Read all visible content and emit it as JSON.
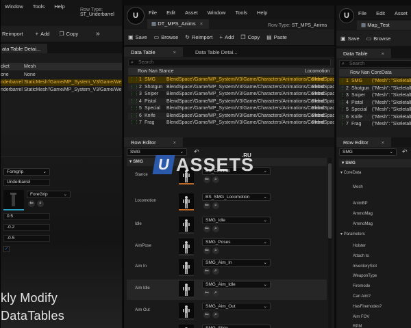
{
  "left_window": {
    "menu": [
      "Window",
      "Tools",
      "Help"
    ],
    "row_type_label": "Row Type:",
    "row_type_value": "ST_Underbarrel",
    "toolbar": {
      "reimport": "Reimport",
      "add": "Add",
      "copy": "Copy",
      "more": "»"
    },
    "tab": "ata Table Detai...",
    "table_headers": [
      "cket",
      "Mesh"
    ],
    "rows": [
      {
        "name": "one",
        "mesh": "None"
      },
      {
        "name": "nderbarrel",
        "mesh": "StaticMesh'/Game/MP_System_V3/Game/We"
      },
      {
        "name": "nderbarrel",
        "mesh": "StaticMesh'/Game/MP_System_V3/Game/We"
      }
    ],
    "foregrip_dropdown": "Foregrip",
    "underbarrel_field": "Underbarrel",
    "mesh_dropdown": "ForeGrip",
    "values": [
      "0.5",
      "-0.2",
      "-0.5"
    ],
    "promo_line1": "kly Modify",
    "promo_line2": "DataTables"
  },
  "center_window": {
    "menu": [
      "File",
      "Edit",
      "Asset",
      "Window",
      "Tools",
      "Help"
    ],
    "tab_title": "DT_MPS_Anims",
    "row_type_label": "Row Type:",
    "row_type_value": "ST_MPS_Anims",
    "toolbar": {
      "save": "Save",
      "browse": "Browse",
      "reimport": "Reimport",
      "add": "Add",
      "copy": "Copy",
      "paste": "Paste"
    },
    "tabs": {
      "data_table": "Data Table",
      "details": "Data Table Detai..."
    },
    "search_placeholder": "Search",
    "headers": {
      "row_name": "Row Nan",
      "stance": "Stance",
      "locomotion": "Locomotion"
    },
    "rows": [
      {
        "idx": "1",
        "name": "SMG",
        "stance": "BlendSpace'/Game/MP_System/V3/Game/Characters/Animations/Combat",
        "loco": "BlendSpace"
      },
      {
        "idx": "2",
        "name": "Shotgun",
        "stance": "BlendSpace'/Game/MP_System/V3/Game/Characters/Animations/Combat",
        "loco": "BlendSpace"
      },
      {
        "idx": "3",
        "name": "Sniper",
        "stance": "BlendSpace'/Game/MP_System/V3/Game/Characters/Animations/Combat",
        "loco": "BlendSpace"
      },
      {
        "idx": "4",
        "name": "Pistol",
        "stance": "BlendSpace'/Game/MP_System/V3/Game/Characters/Animations/Combat",
        "loco": "BlendSpace"
      },
      {
        "idx": "5",
        "name": "Special",
        "stance": "BlendSpace'/Game/MP_System/V3/Game/Characters/Animations/Combat",
        "loco": "BlendSpace"
      },
      {
        "idx": "6",
        "name": "Knife",
        "stance": "BlendSpace'/Game/MP_System/V3/Game/Characters/Animations/Combat",
        "loco": "BlendSpace"
      },
      {
        "idx": "7",
        "name": "Frag",
        "stance": "BlendSpace'/Game/MP_System/V3/Game/Characters/Animations/Combat",
        "loco": "BlendSpace"
      }
    ],
    "row_editor_tab": "Row Editor",
    "row_select": "SMG",
    "section": "SMG",
    "props": [
      {
        "label": "Stance",
        "value": "BS_Combat"
      },
      {
        "label": "Locomotion",
        "value": "BS_SMG_Locomotion"
      },
      {
        "label": "Idle",
        "value": "SMG_Idle"
      },
      {
        "label": "AimPose",
        "value": "SMG_Poses"
      },
      {
        "label": "Aim In",
        "value": "SMG_Aim_In"
      },
      {
        "label": "Aim Idle",
        "value": "SMG_Aim_Idle"
      },
      {
        "label": "Aim Out",
        "value": "SMG_Aim_Out"
      },
      {
        "label": "",
        "value": "SMG_Slide"
      }
    ]
  },
  "right_window": {
    "menu": [
      "File",
      "Edit",
      "Asset"
    ],
    "tab_title": "Map_Test",
    "toolbar": {
      "save": "Save",
      "browse": "Browse"
    },
    "tab": "Data Table",
    "search_placeholder": "Search",
    "headers": {
      "row_name": "Row Nan",
      "core": "CoreData"
    },
    "rows": [
      {
        "idx": "1",
        "name": "SMG",
        "val": "(\"Mesh\": \"SkeletalMe"
      },
      {
        "idx": "2",
        "name": "Shotgun",
        "val": "(\"Mesh\": \"SkeletalMe"
      },
      {
        "idx": "3",
        "name": "Sniper",
        "val": "(\"Mesh\": \"SkeletalMe"
      },
      {
        "idx": "4",
        "name": "Pistol",
        "val": "(\"Mesh\": \"SkeletalMe"
      },
      {
        "idx": "5",
        "name": "Special",
        "val": "(\"Mesh\": \"SkeletalMe"
      },
      {
        "idx": "6",
        "name": "Knife",
        "val": "(\"Mesh\": \"SkeletalMe"
      },
      {
        "idx": "7",
        "name": "Frag",
        "val": "(\"Mesh\": \"SkeletalMe"
      }
    ],
    "row_editor_tab": "Row Editor",
    "row_select": "SMG",
    "section": "SMG",
    "core_section": "CoreData",
    "core_labels": [
      "Mesh",
      "AnimBP",
      "AmmoMag",
      "AmmoMag"
    ],
    "params_section": "Parameters",
    "param_labels": [
      "Holster",
      "Attach to",
      "InventorySlot",
      "WeaponType",
      "Firemode",
      "Can Aim?",
      "HasFiremodes?",
      "Aim FOV",
      "RPM"
    ]
  },
  "watermark": {
    "u": "U",
    "assets": "ASSETS",
    "ru": ".RU"
  },
  "colors": {
    "selection": "#e9b533",
    "accent": "#c06a28",
    "background": "#181818"
  }
}
